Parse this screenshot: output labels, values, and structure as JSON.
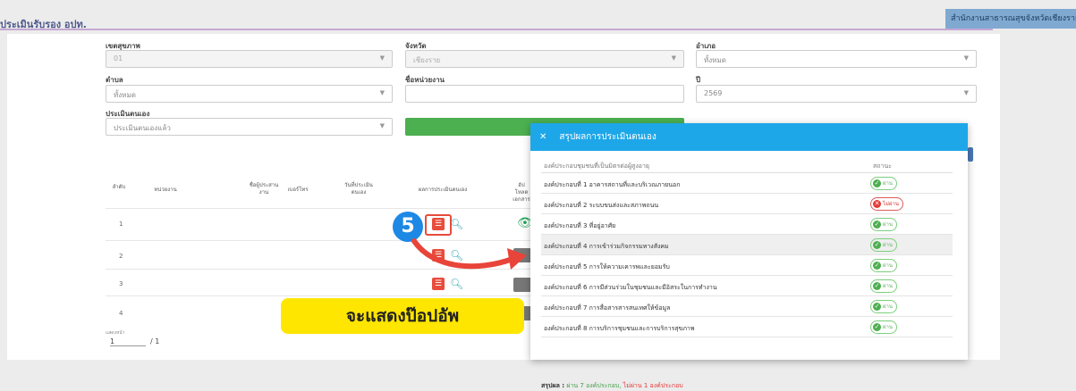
{
  "header": {
    "title": "ประเมินรับรอง อปท.",
    "office_chip": "สำนักงานสาธารณสุขจังหวัดเชียงราย"
  },
  "filters": {
    "health_zone": {
      "label": "เขตสุขภาพ",
      "value": "01"
    },
    "province": {
      "label": "จังหวัด",
      "value": "เชียงราย"
    },
    "district": {
      "label": "อำเภอ",
      "value": "ทั้งหมด"
    },
    "subdistrict": {
      "label": "ตำบล",
      "value": "ทั้งหมด"
    },
    "unit_name": {
      "label": "ชื่อหน่วยงาน",
      "value": ""
    },
    "year": {
      "label": "ปี",
      "value": "2569"
    },
    "self_assess": {
      "label": "ประเมินตนเอง",
      "value": "ประเมินตนเองแล้ว"
    }
  },
  "table": {
    "headers": [
      "ลำดับ",
      "หน่วยงาน",
      "ชื่อผู้ประสานงาน",
      "เบอร์โทร",
      "วันที่ประเมินตนเอง",
      "ผลการประเมินตนเอง",
      "อัปโหลดเอกสาร"
    ],
    "rows": [
      "1",
      "2",
      "3",
      "4"
    ],
    "page_label": "แสดงหน้า",
    "page_current": "1",
    "page_total": "/ 1"
  },
  "annotation": {
    "step_number": "5",
    "callout_text": "จะแสดงป๊อปอัพ",
    "arrow_color": "#e8443a"
  },
  "modal": {
    "close_glyph": "✕",
    "title": "สรุปผลการประเมินตนเอง",
    "col_component": "องค์ประกอบชุมชนที่เป็นมิตรต่อผู้สูงอายุ",
    "col_status": "สถานะ",
    "rows": [
      {
        "label": "องค์ประกอบที่ 1 อาคารสถานที่และบริเวณภายนอก",
        "status": "ผ่าน",
        "pass": true
      },
      {
        "label": "องค์ประกอบที่ 2 ระบบขนส่งและสภาพถนน",
        "status": "ไม่ผ่าน",
        "pass": false
      },
      {
        "label": "องค์ประกอบที่ 3 ที่อยู่อาศัย",
        "status": "ผ่าน",
        "pass": true
      },
      {
        "label": "องค์ประกอบที่ 4 การเข้าร่วมกิจกรรมทางสังคม",
        "status": "ผ่าน",
        "pass": true
      },
      {
        "label": "องค์ประกอบที่ 5 การให้ความเคารพและยอมรับ",
        "status": "ผ่าน",
        "pass": true
      },
      {
        "label": "องค์ประกอบที่ 6 การมีส่วนร่วมในชุมชนและมีอิสระในการทำงาน",
        "status": "ผ่าน",
        "pass": true
      },
      {
        "label": "องค์ประกอบที่ 7 การสื่อสารสารสนเทศให้ข้อมูล",
        "status": "ผ่าน",
        "pass": true
      },
      {
        "label": "องค์ประกอบที่ 8 การบริการชุมชนและการบริการสุขภาพ",
        "status": "ผ่าน",
        "pass": true
      }
    ],
    "summary_label": "สรุปผล :",
    "summary_pass": "ผ่าน 7 องค์ประกอบ,",
    "summary_fail": "ไม่ผ่าน 1 องค์ประกอบ"
  }
}
